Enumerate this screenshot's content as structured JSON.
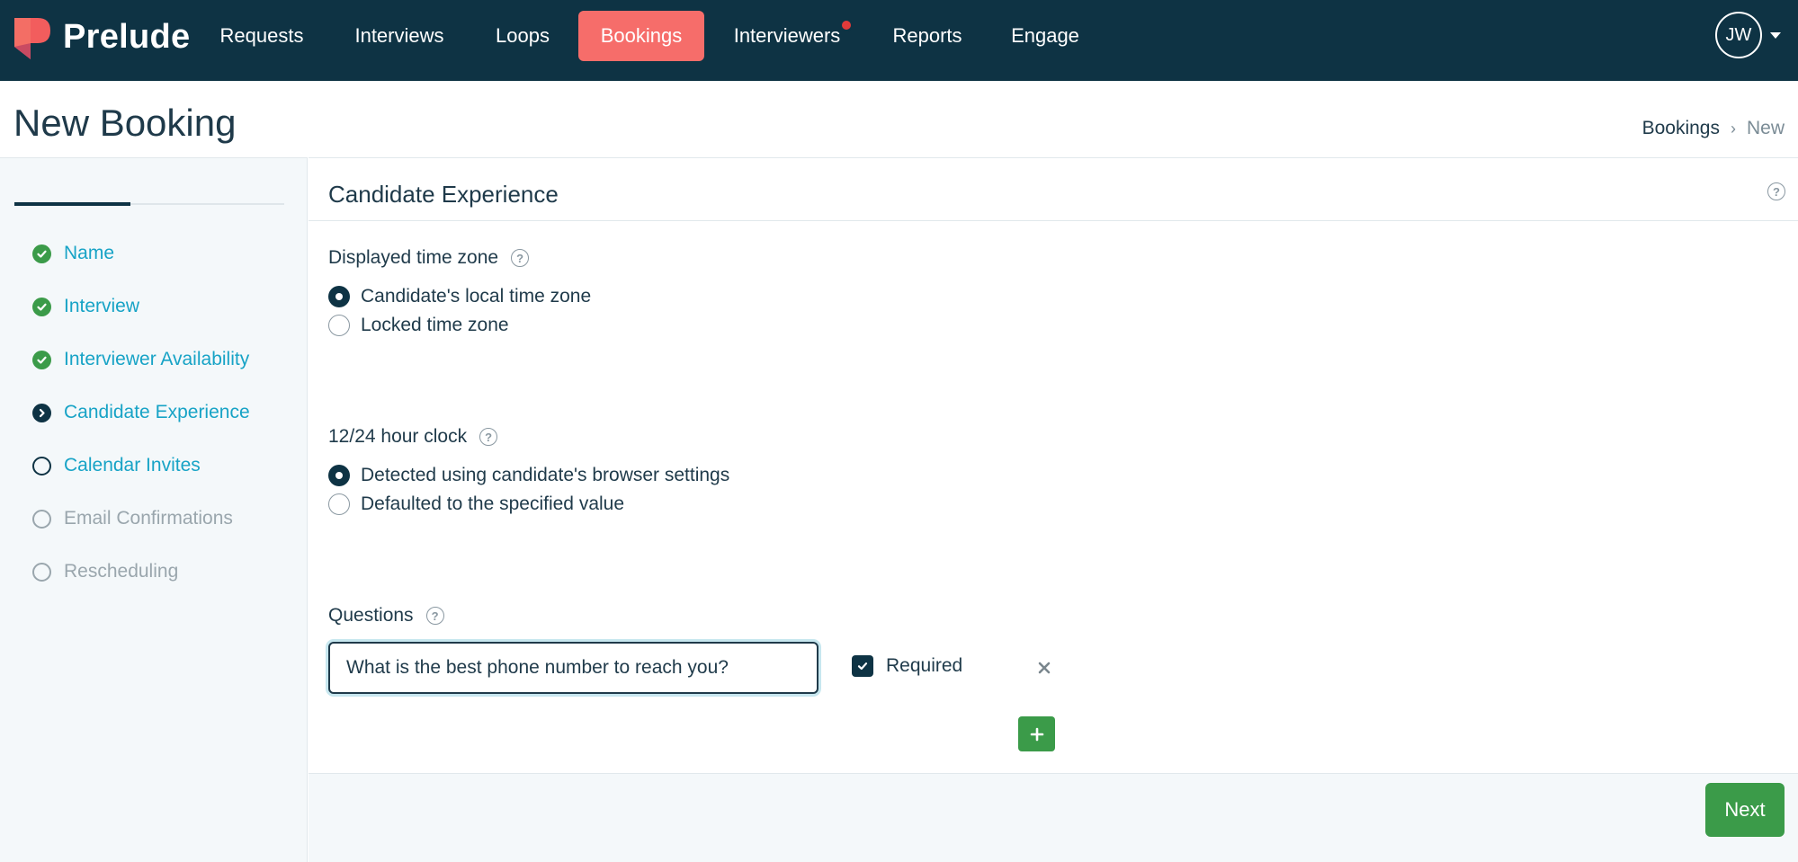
{
  "app": {
    "brand": "Prelude"
  },
  "nav": {
    "items": [
      {
        "label": "Requests"
      },
      {
        "label": "Interviews"
      },
      {
        "label": "Loops"
      },
      {
        "label": "Bookings",
        "active": true
      },
      {
        "label": "Interviewers",
        "notification": true
      },
      {
        "label": "Reports"
      },
      {
        "label": "Engage"
      }
    ],
    "user_initials": "JW"
  },
  "page": {
    "title": "New Booking",
    "breadcrumb": [
      "Bookings",
      "New"
    ],
    "breadcrumb_separator": "›"
  },
  "sidebar": {
    "progress": 0.43,
    "steps": [
      {
        "label": "Name",
        "status": "done"
      },
      {
        "label": "Interview",
        "status": "done"
      },
      {
        "label": "Interviewer Availability",
        "status": "done"
      },
      {
        "label": "Candidate Experience",
        "status": "current"
      },
      {
        "label": "Calendar Invites",
        "status": "todo"
      },
      {
        "label": "Email Confirmations",
        "status": "todo-muted"
      },
      {
        "label": "Rescheduling",
        "status": "todo-muted"
      }
    ]
  },
  "section": {
    "title": "Candidate Experience",
    "timezone": {
      "label": "Displayed time zone",
      "options": [
        {
          "label": "Candidate's local time zone",
          "selected": true
        },
        {
          "label": "Locked time zone",
          "selected": false
        }
      ]
    },
    "clock": {
      "label": "12/24 hour clock",
      "options": [
        {
          "label": "Detected using candidate's browser settings",
          "selected": true
        },
        {
          "label": "Defaulted to the specified value",
          "selected": false
        }
      ]
    },
    "questions": {
      "label": "Questions",
      "items": [
        {
          "value": "What is the best phone number to reach you?",
          "required": true,
          "required_label": "Required"
        }
      ]
    }
  },
  "footer": {
    "next_label": "Next"
  },
  "colors": {
    "nav_bg": "#0e3344",
    "nav_active": "#f66d6a",
    "step_link": "#17a3c6",
    "success": "#3b9b49",
    "muted": "#9aa6ad"
  }
}
